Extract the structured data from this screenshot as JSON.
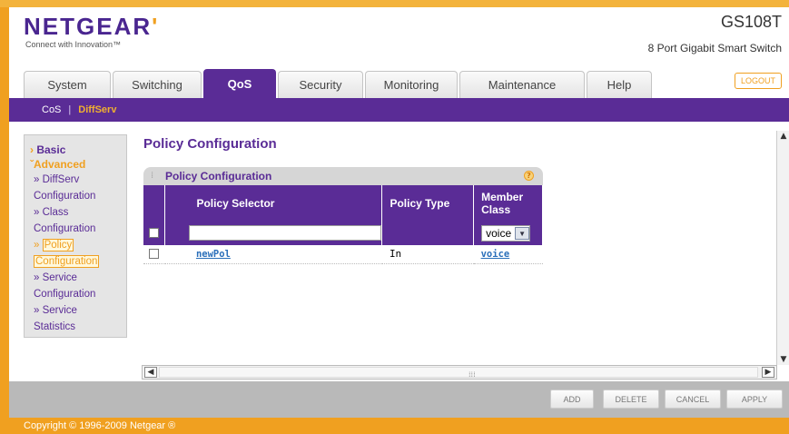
{
  "header": {
    "logo": "NETGEAR",
    "logo_mark": "'",
    "tagline": "Connect with Innovation™",
    "model": "GS108T",
    "model_desc": "8 Port Gigabit Smart Switch"
  },
  "tabs": [
    {
      "label": "System"
    },
    {
      "label": "Switching"
    },
    {
      "label": "QoS",
      "active": true
    },
    {
      "label": "Security"
    },
    {
      "label": "Monitoring"
    },
    {
      "label": "Maintenance"
    },
    {
      "label": "Help"
    }
  ],
  "logout_label": "LOGOUT",
  "subnav": {
    "items": [
      {
        "label": "CoS"
      },
      {
        "label": "DiffServ",
        "active": true
      }
    ],
    "separator": "|"
  },
  "sidebar": {
    "basic": "Basic",
    "advanced": "Advanced",
    "items": [
      {
        "prefix": "»",
        "line1": "DiffServ",
        "line2": "Configuration"
      },
      {
        "prefix": "»",
        "line1": "Class",
        "line2": "Configuration"
      },
      {
        "prefix": "»",
        "line1": "Policy",
        "line2": "Configuration",
        "active": true
      },
      {
        "prefix": "»",
        "line1": "Service",
        "line2": "Configuration"
      },
      {
        "prefix": "»",
        "line1": "Service",
        "line2": "Statistics"
      }
    ]
  },
  "page_title": "Policy Configuration",
  "panel": {
    "title": "Policy Configuration",
    "help_icon": "?",
    "columns": [
      "Policy Selector",
      "Policy Type",
      "Member Class"
    ],
    "input_row": {
      "policy_selector": "",
      "member_class_selected": "voice"
    },
    "rows": [
      {
        "policy_selector": "newPol",
        "policy_type": "In",
        "member_class": "voice"
      }
    ]
  },
  "buttons": {
    "add": "ADD",
    "delete": "DELETE",
    "cancel": "CANCEL",
    "apply": "APPLY"
  },
  "footer": "Copyright © 1996-2009 Netgear ®",
  "colors": {
    "brand_purple": "#5a2c96",
    "brand_orange": "#f0a020",
    "link": "#2a6fba"
  }
}
